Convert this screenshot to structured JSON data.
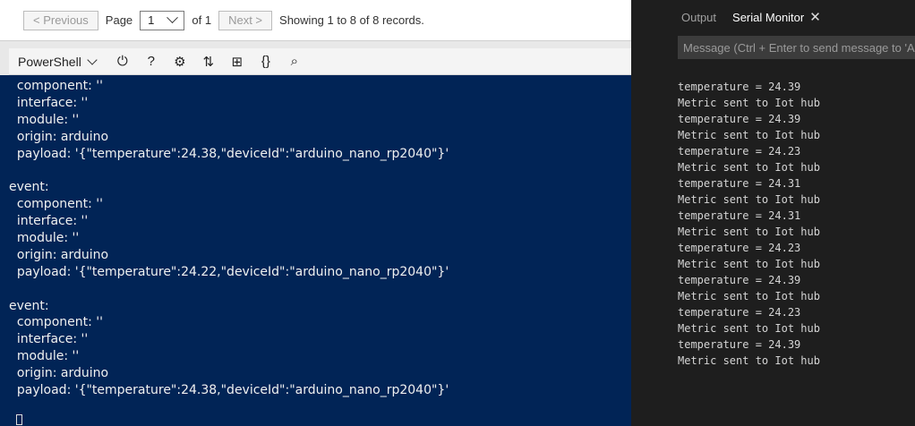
{
  "pager": {
    "previous": "< Previous",
    "page_label": "Page",
    "page_value": "1",
    "of_label": "of 1",
    "next": "Next >",
    "summary": "Showing 1 to 8 of 8 records."
  },
  "shell": {
    "name": "PowerShell",
    "tools": [
      {
        "icon": "power-icon",
        "glyph": "⏻"
      },
      {
        "icon": "help-icon",
        "glyph": "?"
      },
      {
        "icon": "settings-gear-icon",
        "glyph": "⚙"
      },
      {
        "icon": "upload-download-icon",
        "glyph": "⇅"
      },
      {
        "icon": "new-session-icon",
        "glyph": "⊞"
      },
      {
        "icon": "braces-icon",
        "glyph": "{}"
      },
      {
        "icon": "web-preview-icon",
        "glyph": "⌕"
      }
    ]
  },
  "terminal_lines": [
    "  component: ''",
    "  interface: ''",
    "  module: ''",
    "  origin: arduino",
    "  payload: '{\"temperature\":24.38,\"deviceId\":\"arduino_nano_rp2040\"}'",
    "",
    "event:",
    "  component: ''",
    "  interface: ''",
    "  module: ''",
    "  origin: arduino",
    "  payload: '{\"temperature\":24.22,\"deviceId\":\"arduino_nano_rp2040\"}'",
    "",
    "event:",
    "  component: ''",
    "  interface: ''",
    "  module: ''",
    "  origin: arduino",
    "  payload: '{\"temperature\":24.38,\"deviceId\":\"arduino_nano_rp2040\"}'"
  ],
  "panel": {
    "tab_output": "Output",
    "tab_serial": "Serial Monitor",
    "close_glyph": "✕",
    "message_placeholder": "Message (Ctrl + Enter to send message to 'A"
  },
  "serial_lines": [
    "temperature = 24.39",
    "Metric sent to Iot hub",
    "temperature = 24.39",
    "Metric sent to Iot hub",
    "temperature = 24.23",
    "Metric sent to Iot hub",
    "temperature = 24.31",
    "Metric sent to Iot hub",
    "temperature = 24.31",
    "Metric sent to Iot hub",
    "temperature = 24.23",
    "Metric sent to Iot hub",
    "temperature = 24.39",
    "Metric sent to Iot hub",
    "temperature = 24.23",
    "Metric sent to Iot hub",
    "temperature = 24.39",
    "Metric sent to Iot hub"
  ],
  "colors": {
    "terminal_bg": "#012456",
    "panel_bg": "#1e1e1e"
  }
}
